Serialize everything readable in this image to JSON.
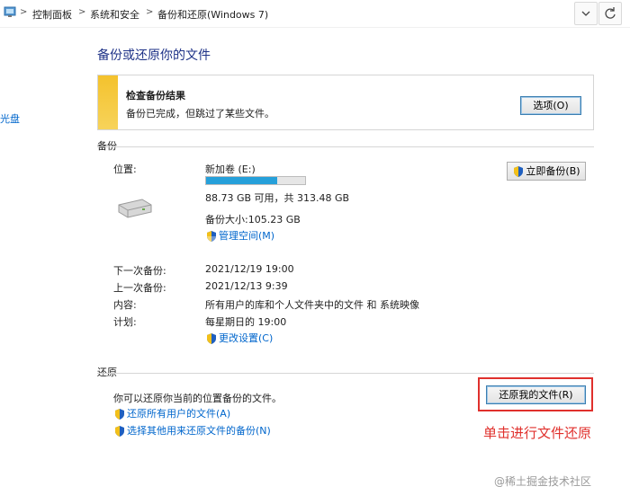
{
  "breadcrumb": {
    "items": [
      "控制面板",
      "系统和安全",
      "备份和还原(Windows 7)"
    ],
    "separator": ">"
  },
  "sidebar": {
    "partial_link": "光盘"
  },
  "page": {
    "title": "备份或还原你的文件"
  },
  "notice": {
    "title": "检查备份结果",
    "message": "备份已完成，但跳过了某些文件。",
    "options_button": "选项(O)",
    "accent_color": "#f4c22d"
  },
  "backup": {
    "section_title": "备份",
    "location_label": "位置:",
    "location_value": "新加卷 (E:)",
    "usage_fraction": 0.72,
    "free_space": "88.73 GB 可用，共 313.48 GB",
    "backup_size": "备份大小:105.23 GB",
    "manage_space_link": "管理空间(M)",
    "backup_now_button": "立即备份(B)",
    "next_backup_label": "下一次备份:",
    "next_backup_value": "2021/12/19 19:00",
    "last_backup_label": "上一次备份:",
    "last_backup_value": "2021/12/13 9:39",
    "contents_label": "内容:",
    "contents_value": "所有用户的库和个人文件夹中的文件 和 系统映像",
    "schedule_label": "计划:",
    "schedule_value": "每星期日的 19:00",
    "change_settings_link": "更改设置(C)"
  },
  "restore": {
    "section_title": "还原",
    "description": "你可以还原你当前的位置备份的文件。",
    "restore_my_files_button": "还原我的文件(R)",
    "restore_all_users_link": "还原所有用户的文件(A)",
    "select_other_backup_link": "选择其他用来还原文件的备份(N)"
  },
  "annotation": {
    "text": "单击进行文件还原",
    "color": "#e0302c"
  },
  "watermark": "@稀土掘金技术社区",
  "colors": {
    "link": "#0066cc",
    "title": "#1e3287",
    "progress": "#26a0da"
  }
}
